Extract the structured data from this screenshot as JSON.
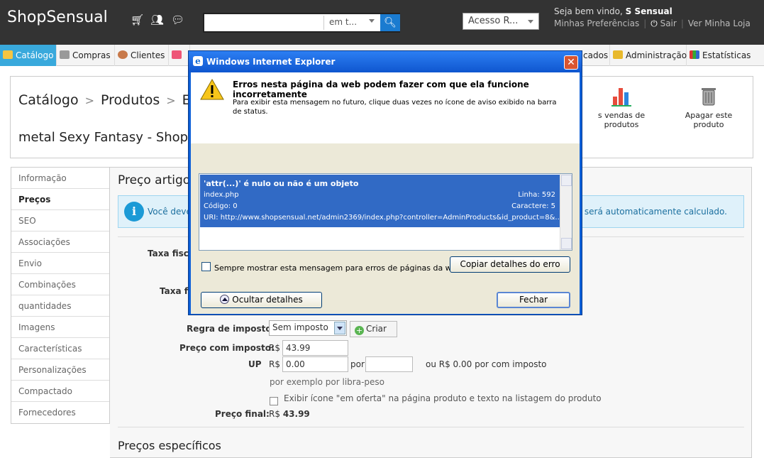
{
  "header": {
    "shop_name": "ShopSensual",
    "search_placeholder": "",
    "search_scope": "em t...",
    "access_select": "Acesso R...",
    "welcome_prefix": "Seja bem vindo,",
    "welcome_user": "S Sensual",
    "link_prefs": "Minhas Preferências",
    "link_logout": "Sair",
    "link_store": "Ver Minha Loja"
  },
  "menu": {
    "catalogo": "Catálogo",
    "compras": "Compras",
    "clientes": "Clientes",
    "avancados": "cados",
    "administracao": "Administração",
    "estatisticas": "Estatísticas"
  },
  "page": {
    "breadcrumb_1": "Catálogo",
    "breadcrumb_2": "Produtos",
    "breadcrumb_3": "E",
    "product_title": "metal Sexy Fantasy - ShopS",
    "toolbar_sales": "s vendas de produtos",
    "toolbar_delete": "Apagar este produto"
  },
  "sidebar": {
    "items": [
      "Informação",
      "Preços",
      "SEO",
      "Associações",
      "Envio",
      "Combinações",
      "quantidades",
      "Imagens",
      "Características",
      "Personalizações",
      "Compactado",
      "Fornecedores"
    ]
  },
  "main": {
    "title": "Preço artigo",
    "info_text_left": "Você deve",
    "info_text_right": "ada será automaticamente calculado.",
    "label_taxa1": "Taxa fisca",
    "label_taxa2": "Taxa fis",
    "label_regra": "Regra de imposto:",
    "tax_select_value": "Sem imposto",
    "criar_label": "Criar",
    "label_preco_imposto": "Preço com imposto:",
    "currency": "R$",
    "preco_imposto_value": "43.99",
    "label_up": "UP",
    "up_value": "0.00",
    "por_label": "por",
    "up_per_value": "",
    "up_alt": "ou R$ 0.00 por com imposto",
    "up_hint": "por exemplo por libra-peso",
    "oferta_label": "Exibir ícone \"em oferta\" na página produto e texto na listagem do produto",
    "label_preco_final": "Preço final:",
    "preco_final_value": "43.99",
    "sub_title": "Preços específicos"
  },
  "dialog": {
    "title": "Windows Internet Explorer",
    "message_title": "Erros nesta página da web podem fazer com que ela funcione incorretamente",
    "message_sub": "Para exibir esta mensagem no futuro, clique duas vezes no ícone de aviso exibido na barra de status.",
    "error_message": "'attr(...)' é nulo ou não é um objeto",
    "error_file": "index.php",
    "error_line": "Linha: 592",
    "error_code": "Código: 0",
    "error_char": "Caractere: 5",
    "error_uri": "URI: http://www.shopsensual.net/admin2369/index.php?controller=AdminProducts&id_product=8&...",
    "always_show_label": "Sempre mostrar esta mensagem para erros de páginas da web",
    "copy_button": "Copiar detalhes do erro",
    "hide_button": "Ocultar detalhes",
    "close_button": "Fechar"
  },
  "colors": {
    "header_bg": "#333333",
    "menu_active": "#39a9dc",
    "info_bg": "#dff1fa",
    "dialog_title_bg": "#0f56cf",
    "selection_bg": "#316ac5"
  }
}
